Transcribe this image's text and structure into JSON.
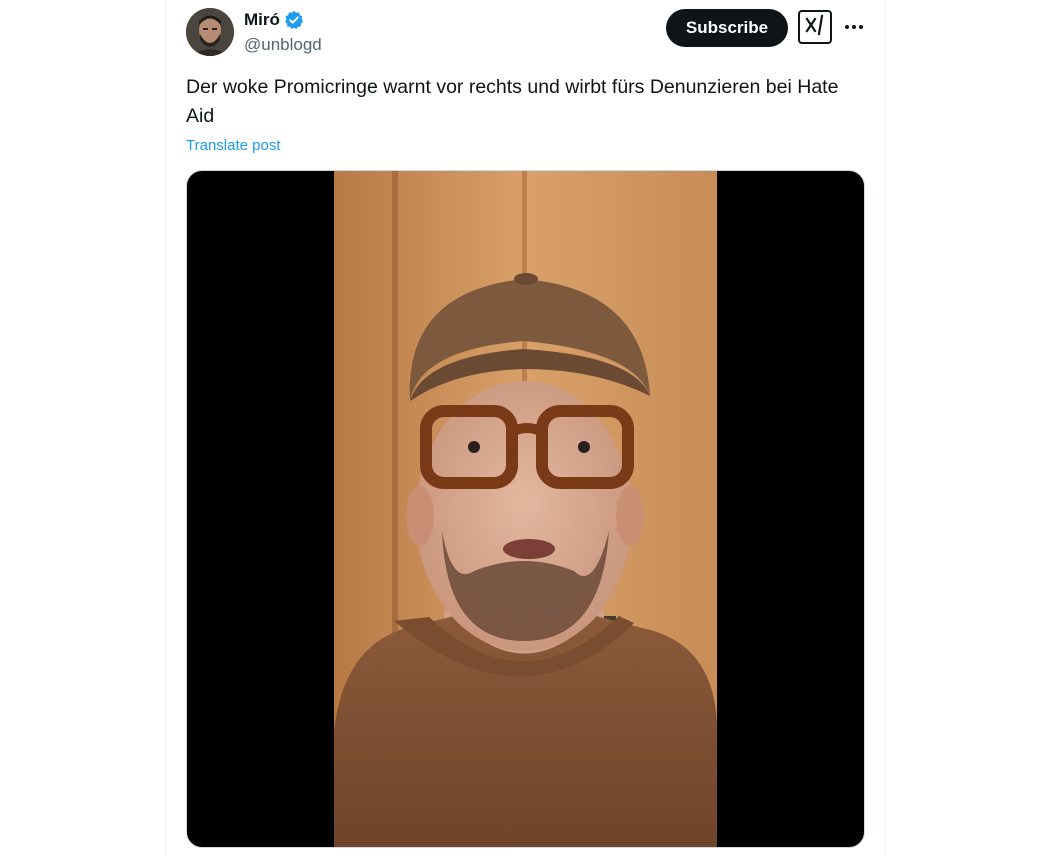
{
  "author": {
    "display_name": "Miró",
    "handle": "@unblogd",
    "verified": true,
    "verified_color": "#1d9bf0"
  },
  "actions": {
    "subscribe_label": "Subscribe",
    "grok_icon": "grok-icon",
    "more_icon": "more-horizontal-icon"
  },
  "post": {
    "text": "Der woke Promicringe warnt vor rechts und wirbt fürs Denunzieren bei Hate Aid",
    "translate_label": "Translate post"
  },
  "media": {
    "type": "video",
    "background": "#000000"
  },
  "colors": {
    "text_primary": "#0f1419",
    "text_secondary": "#536471",
    "link": "#1d9bf0",
    "button_dark": "#0f1419"
  }
}
